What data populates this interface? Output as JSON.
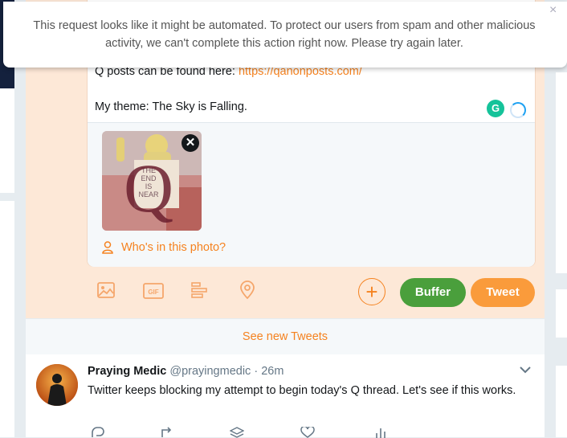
{
  "notice": {
    "message": "This request looks like it might be automated. To protect our users from spam and other malicious activity, we can't complete this action right now. Please try again later.",
    "close_glyph": "×"
  },
  "compose": {
    "line_prefix": "Q posts can be found here: ",
    "link": "https://qanonposts.com/",
    "line_theme": "My theme: The Sky is Falling.",
    "grammarly_glyph": "G",
    "media": {
      "remove_glyph": "✕",
      "sign_text": [
        "THE",
        "END",
        "IS",
        "NEAR"
      ],
      "q_letter": "Q",
      "tag_label": "Who's in this photo?"
    },
    "toolbar": {
      "icons": [
        "image-icon",
        "gif-icon",
        "poll-icon",
        "location-icon"
      ],
      "gif_text": "GIF",
      "plus_glyph": "+",
      "buffer_label": "Buffer",
      "tweet_label": "Tweet"
    }
  },
  "see_new_tweets": "See new Tweets",
  "tweet": {
    "name": "Praying Medic",
    "handle": "@prayingmedic",
    "separator": "·",
    "time": "26m",
    "text": "Twitter keeps blocking my attempt to begin today's Q thread. Let's see if this works.",
    "actions": [
      "reply-icon",
      "retweet-icon",
      "buffer-icon",
      "like-icon",
      "analytics-icon"
    ]
  },
  "colors": {
    "accent": "#f5821f",
    "compose_bg": "#fde8d7",
    "buffer_green": "#4a9f3c",
    "tweet_orange": "#fa9b3b",
    "grammarly_green": "#15c39a"
  }
}
